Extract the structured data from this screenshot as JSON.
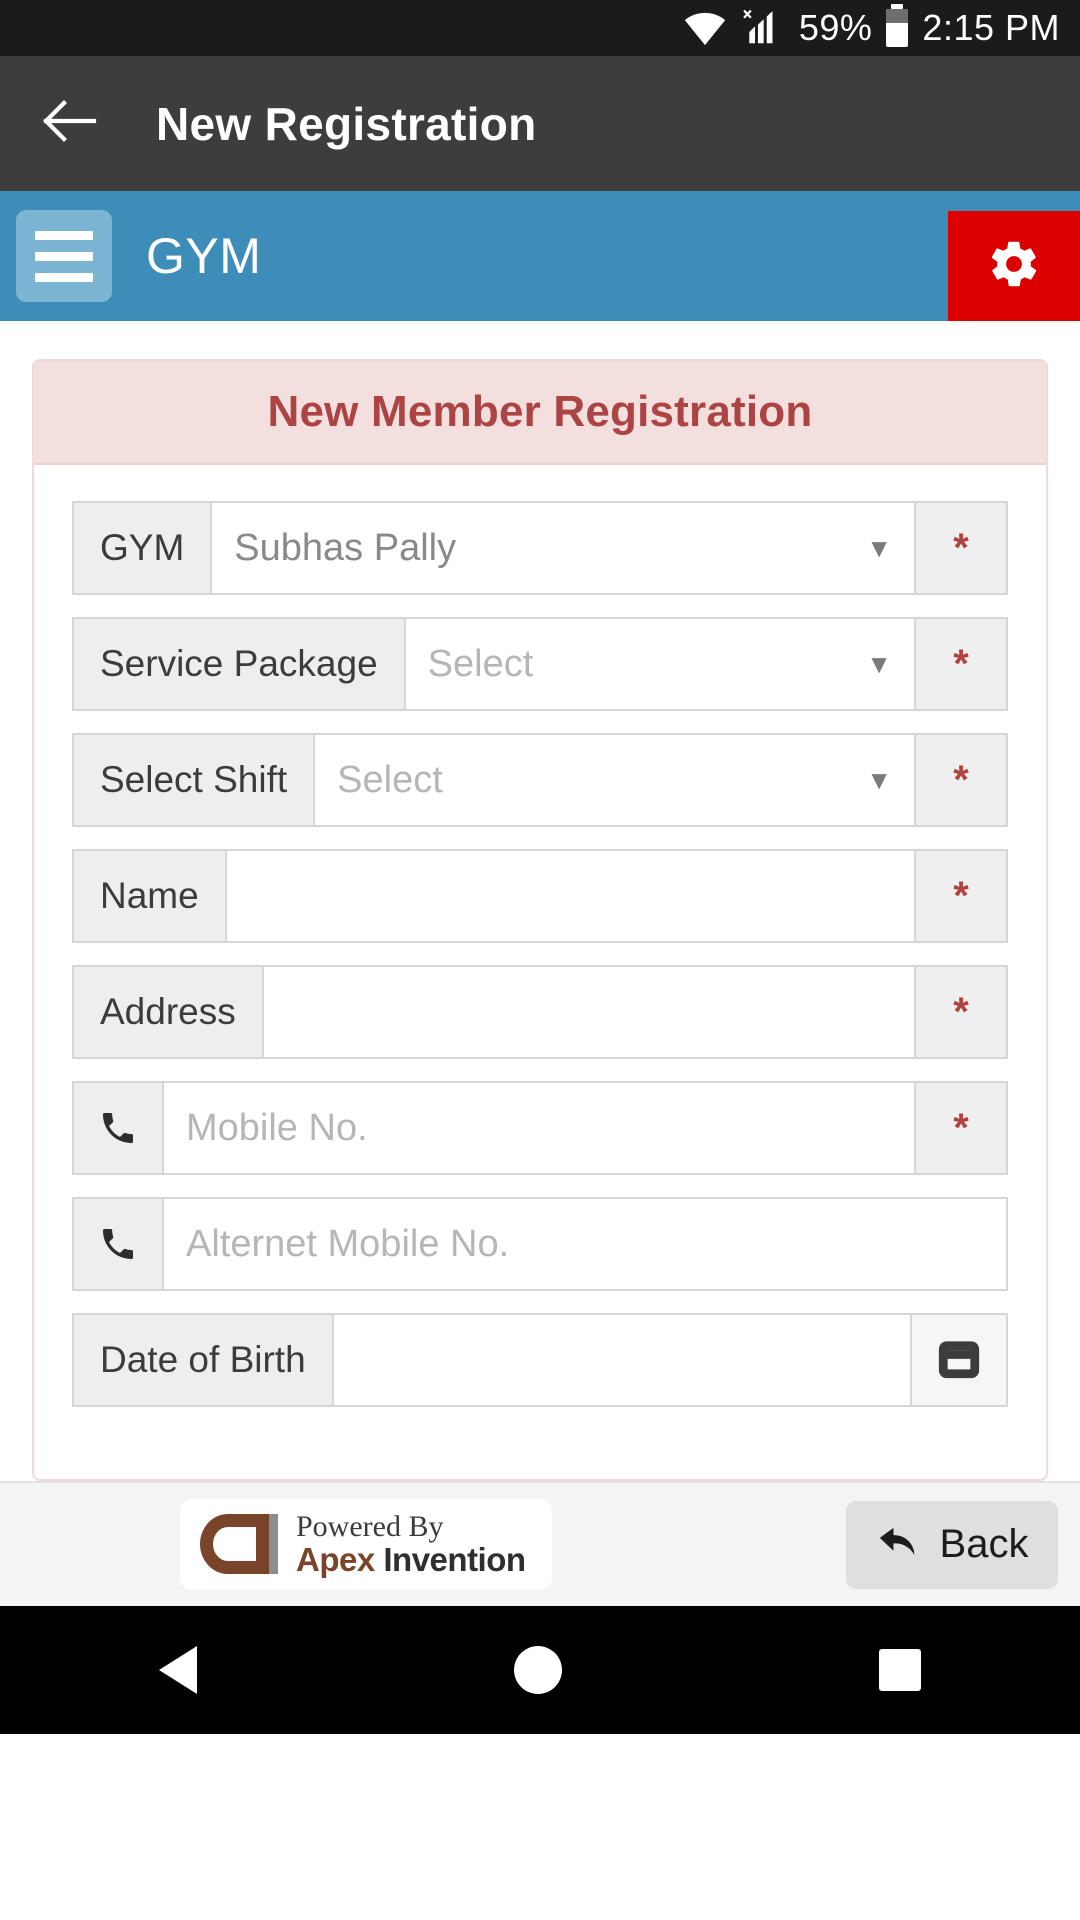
{
  "status_bar": {
    "wifi_icon": "wifi-icon",
    "signal_icon": "signal-no-sim-icon",
    "battery_text": "59%",
    "battery_icon": "battery-icon",
    "time": "2:15 PM"
  },
  "app_bar": {
    "back_icon": "arrow-left-icon",
    "title": "New Registration"
  },
  "blue_header": {
    "menu_icon": "hamburger-menu-icon",
    "title": "GYM",
    "settings_icon": "gear-icon",
    "background_color": "#3e8cb8",
    "settings_color": "#dd0000"
  },
  "card": {
    "title": "New Member Registration",
    "title_color": "#ab4442",
    "header_bg": "#f4dfdf"
  },
  "form": {
    "required_marker": "*",
    "caret_glyph": "▼",
    "rows": [
      {
        "label": "GYM",
        "value": "Subhas Pally",
        "type": "select",
        "required": true,
        "placeholder": false
      },
      {
        "label": "Service Package",
        "value": "Select",
        "type": "select",
        "required": true,
        "placeholder": true
      },
      {
        "label": "Select Shift",
        "value": "Select",
        "type": "select",
        "required": true,
        "placeholder": true
      },
      {
        "label": "Name",
        "value": "",
        "type": "text",
        "required": true,
        "placeholder": false
      },
      {
        "label": "Address",
        "value": "",
        "type": "text",
        "required": true,
        "placeholder": false
      },
      {
        "label": "",
        "value": "Mobile No.",
        "type": "phone",
        "required": true,
        "placeholder": true,
        "icon": "phone-icon"
      },
      {
        "label": "",
        "value": "Alternet Mobile No.",
        "type": "phone",
        "required": false,
        "placeholder": true,
        "icon": "phone-icon"
      },
      {
        "label": "Date of Birth",
        "value": "",
        "type": "date",
        "required": false,
        "placeholder": false,
        "icon": "calendar-icon"
      }
    ]
  },
  "footer": {
    "logo_line1": "Powered By",
    "logo_apex": "Apex ",
    "logo_invention": "Invention",
    "back_label": "Back",
    "back_icon": "undo-arrow-icon"
  },
  "nav_bar": {
    "back_icon": "nav-back-triangle-icon",
    "home_icon": "nav-home-circle-icon",
    "recents_icon": "nav-recents-square-icon"
  }
}
